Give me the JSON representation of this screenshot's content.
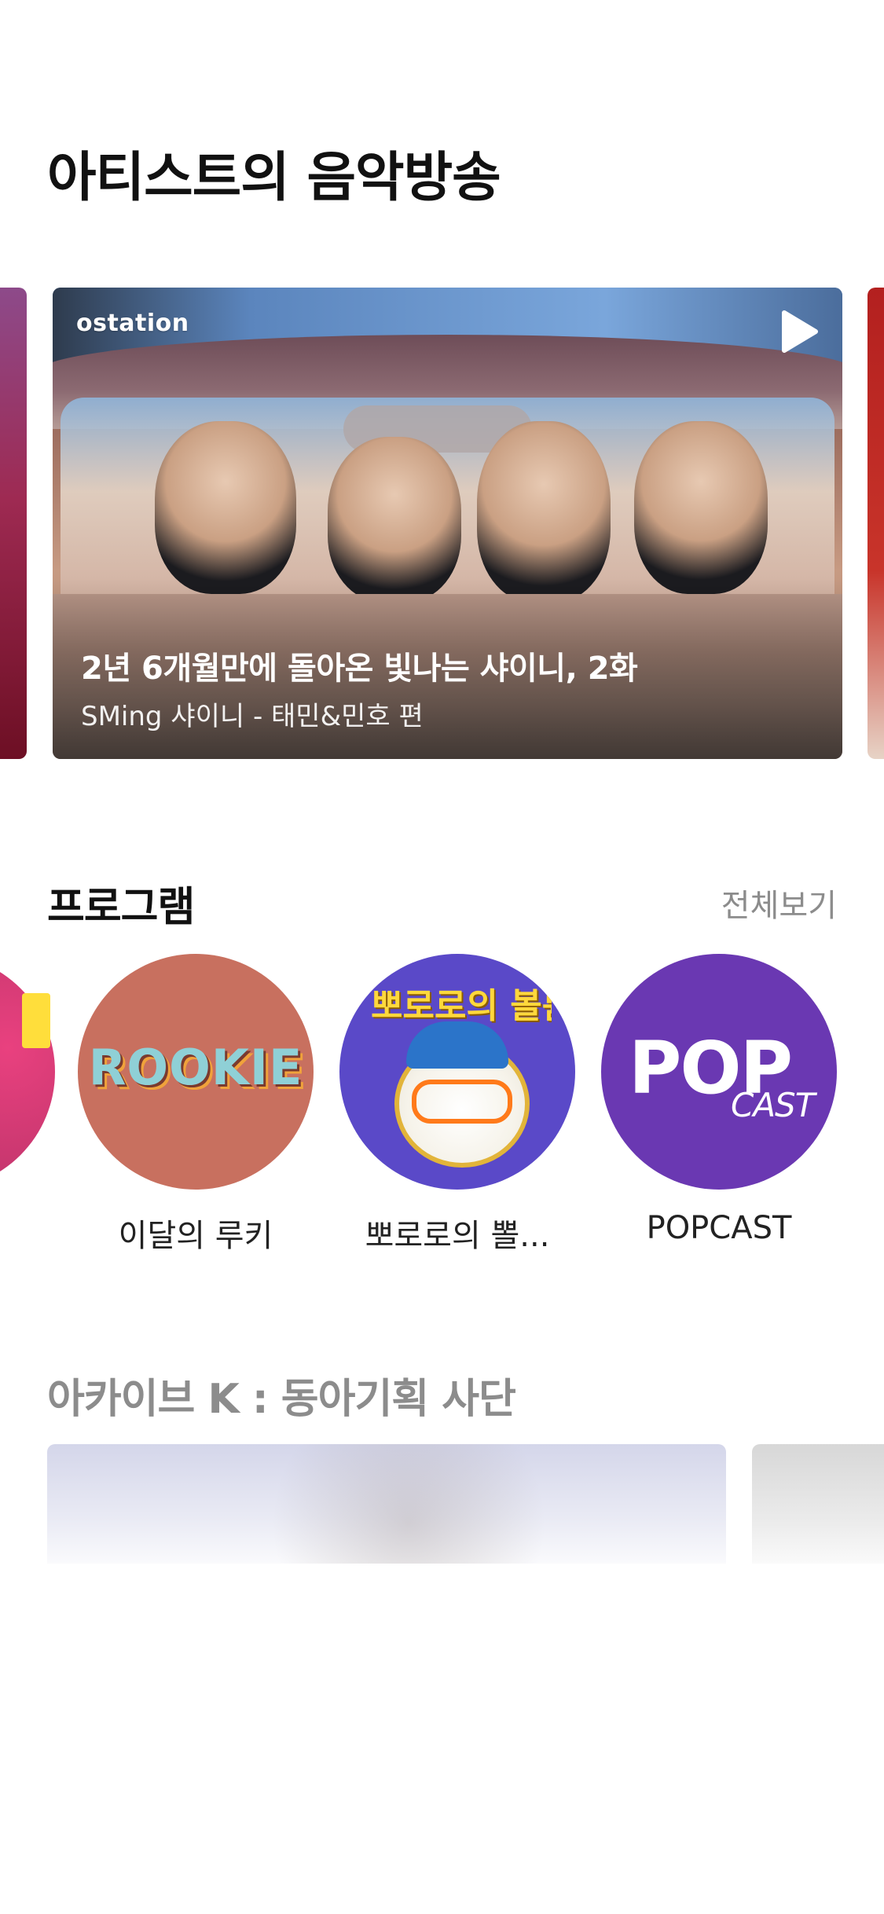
{
  "sections": {
    "artist_broadcast": {
      "title": "아티스트의 음악방송",
      "featured": {
        "brand": "ostation",
        "title": "2년 6개월만에 돌아온 빛나는 샤이니, 2화",
        "subtitle": "SMing 샤이니 - 태민&민호 편",
        "play_icon": "play-icon"
      }
    },
    "programs": {
      "title": "프로그램",
      "see_all_label": "전체보기",
      "items": [
        {
          "label": "이달의 루키",
          "art_text": "ROOKIE"
        },
        {
          "label": "뽀로로의 뽈...",
          "art_text": "뽀로로의 볼륨을 높여요"
        },
        {
          "label": "POPCAST",
          "art_text_main": "POP",
          "art_text_sub": "CAST"
        }
      ]
    },
    "archive": {
      "title": "아카이브 K : 동아기획 사단"
    }
  },
  "colors": {
    "accent_gray": "#8c8c8c",
    "rookie_bg": "#c8705f",
    "pororo_bg": "#5a49c8",
    "popcast_bg": "#6a38b2"
  }
}
